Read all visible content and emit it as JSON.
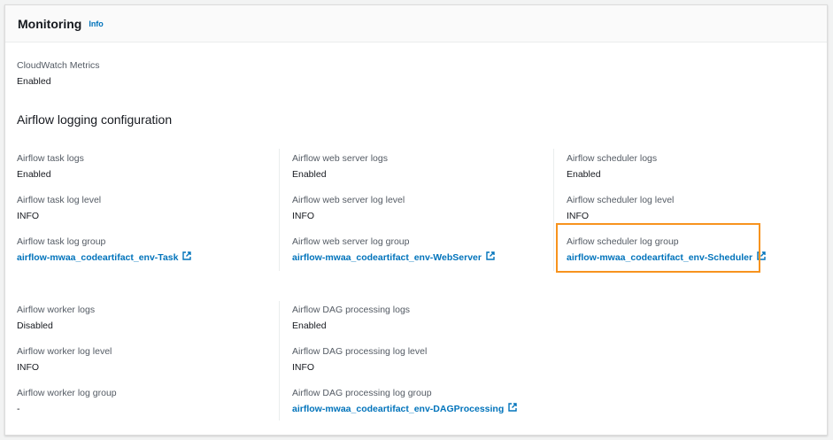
{
  "header": {
    "title": "Monitoring",
    "info": "Info"
  },
  "cloudwatch": {
    "label": "CloudWatch Metrics",
    "value": "Enabled"
  },
  "section_title": "Airflow logging configuration",
  "columns": [
    {
      "fields": [
        {
          "label": "Airflow task logs",
          "value": "Enabled"
        },
        {
          "label": "Airflow task log level",
          "value": "INFO"
        },
        {
          "label": "Airflow task log group",
          "link": "airflow-mwaa_codeartifact_env-Task"
        }
      ]
    },
    {
      "fields": [
        {
          "label": "Airflow web server logs",
          "value": "Enabled"
        },
        {
          "label": "Airflow web server log level",
          "value": "INFO"
        },
        {
          "label": "Airflow web server log group",
          "link": "airflow-mwaa_codeartifact_env-WebServer"
        }
      ]
    },
    {
      "fields": [
        {
          "label": "Airflow scheduler logs",
          "value": "Enabled"
        },
        {
          "label": "Airflow scheduler log level",
          "value": "INFO"
        },
        {
          "label": "Airflow scheduler log group",
          "link": "airflow-mwaa_codeartifact_env-Scheduler"
        }
      ]
    },
    {
      "fields": [
        {
          "label": "Airflow worker logs",
          "value": "Disabled"
        },
        {
          "label": "Airflow worker log level",
          "value": "INFO"
        },
        {
          "label": "Airflow worker log group",
          "value": "-"
        }
      ]
    },
    {
      "fields": [
        {
          "label": "Airflow DAG processing logs",
          "value": "Enabled"
        },
        {
          "label": "Airflow DAG processing log level",
          "value": "INFO"
        },
        {
          "label": "Airflow DAG processing log group",
          "link": "airflow-mwaa_codeartifact_env-DAGProcessing"
        }
      ]
    }
  ],
  "highlight_color": "#f7931e"
}
